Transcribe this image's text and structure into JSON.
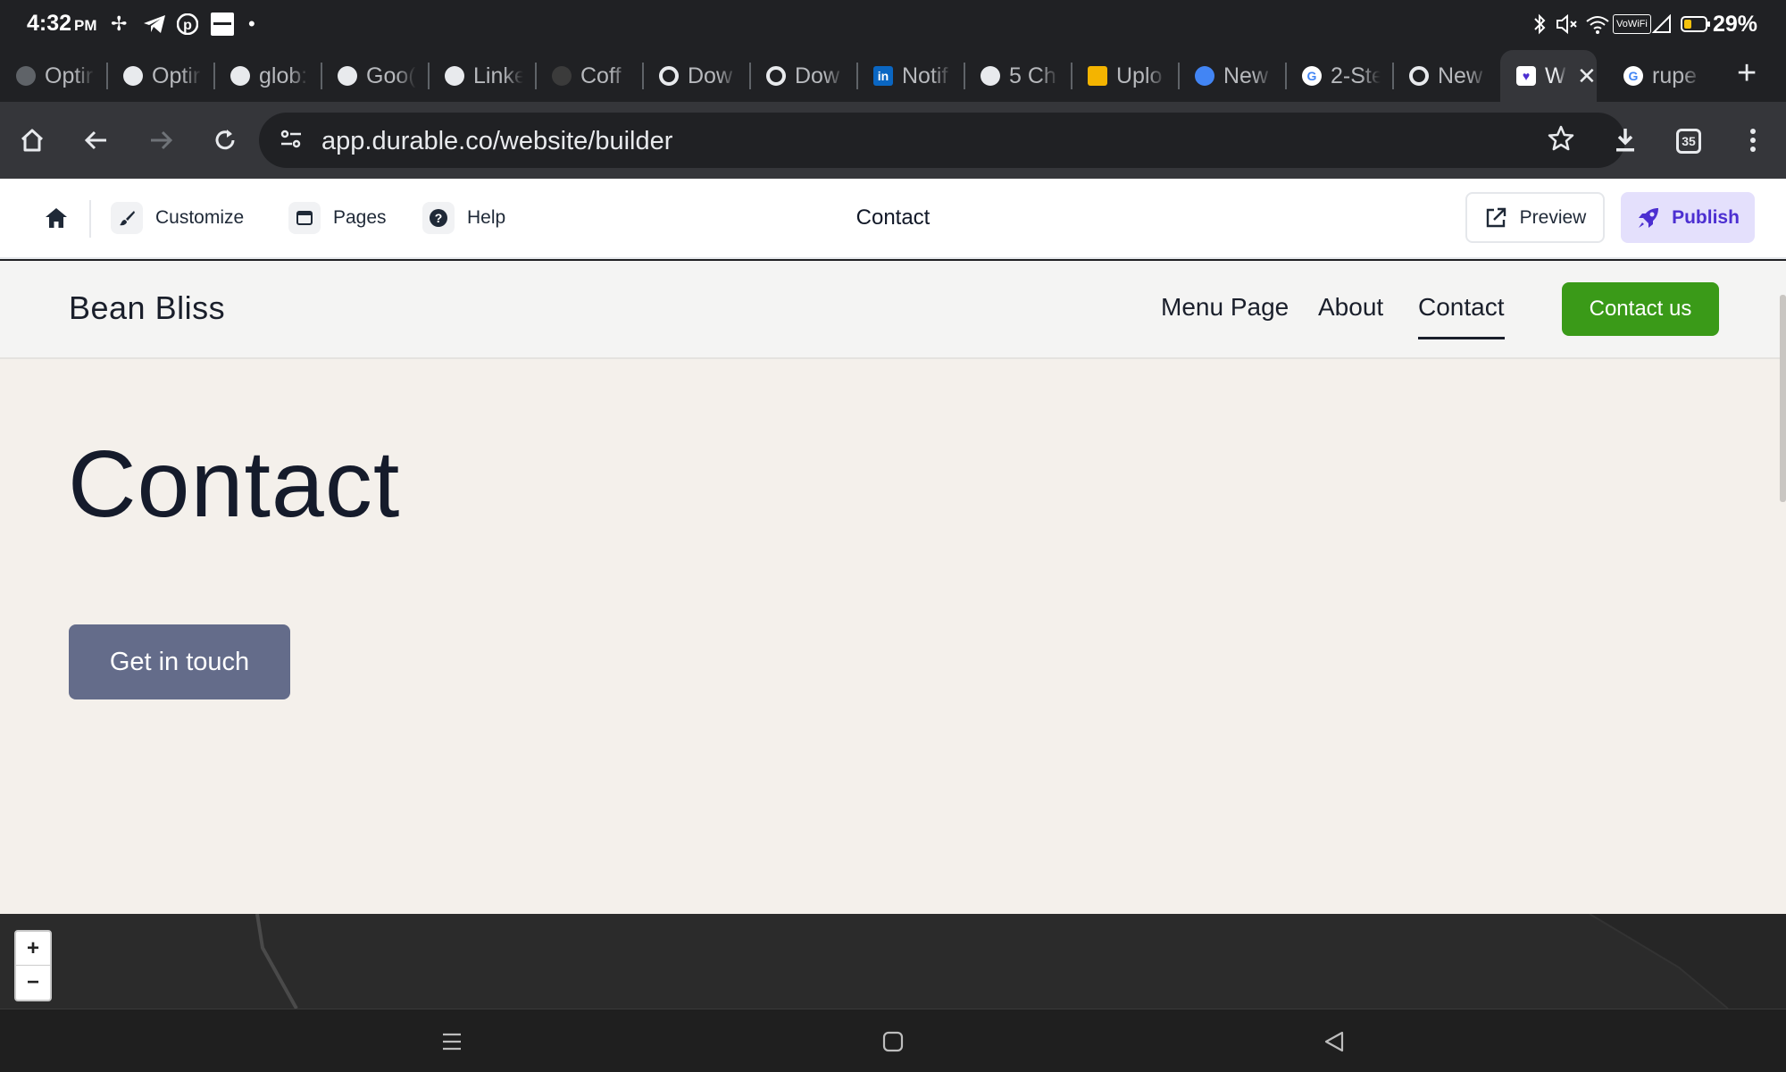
{
  "status_bar": {
    "time": "4:32",
    "ampm": "PM",
    "battery_percent": "29%",
    "vowifi": "VoWiFi"
  },
  "tabs": [
    {
      "label": "Optir",
      "favicon": "globe-icon",
      "color": "#5f6368"
    },
    {
      "label": "Optir",
      "favicon": "globe-icon",
      "color": "#e8eaed"
    },
    {
      "label": "glob:",
      "favicon": "globe-icon",
      "color": "#e8eaed"
    },
    {
      "label": "Goo(",
      "favicon": "globe-icon",
      "color": "#e8eaed"
    },
    {
      "label": "Linke",
      "favicon": "globe-icon",
      "color": "#e8eaed"
    },
    {
      "label": "Coff",
      "favicon": "pinwheel-icon",
      "color": "#3b3b3b"
    },
    {
      "label": "Dow",
      "favicon": "chrome-icon",
      "color": "#e8eaed"
    },
    {
      "label": "Dow",
      "favicon": "chrome-icon",
      "color": "#e8eaed"
    },
    {
      "label": "Notif",
      "favicon": "linkedin-icon",
      "color": "#0a66c2"
    },
    {
      "label": "5 Ch",
      "favicon": "globe-icon",
      "color": "#e8eaed"
    },
    {
      "label": "Uplo",
      "favicon": "upload-icon",
      "color": "#f4b400"
    },
    {
      "label": "New",
      "favicon": "google-ads-icon",
      "color": "#4285f4"
    },
    {
      "label": "2-Ste",
      "favicon": "google-icon",
      "color": "#ffffff"
    },
    {
      "label": "New",
      "favicon": "chrome-icon",
      "color": "#e8eaed"
    },
    {
      "label": "W",
      "favicon": "durable-icon",
      "color": "#ffffff",
      "active": true
    },
    {
      "label": "rupe",
      "favicon": "google-icon",
      "color": "#ffffff"
    }
  ],
  "browser": {
    "url": "app.durable.co/website/builder",
    "tab_count": "35"
  },
  "builder": {
    "customize": "Customize",
    "pages": "Pages",
    "help": "Help",
    "page_title": "Contact",
    "preview": "Preview",
    "publish": "Publish",
    "publish_color": "#4c2fd1"
  },
  "site": {
    "brand": "Bean Bliss",
    "nav": [
      "Menu Page",
      "About",
      "Contact"
    ],
    "current_nav": "Contact",
    "cta": "Contact us",
    "cta_color": "#3a9a18",
    "hero_title": "Contact",
    "hero_button": "Get in touch",
    "hero_button_color": "#646c8a"
  },
  "map": {
    "zoom_in": "+",
    "zoom_out": "−"
  }
}
